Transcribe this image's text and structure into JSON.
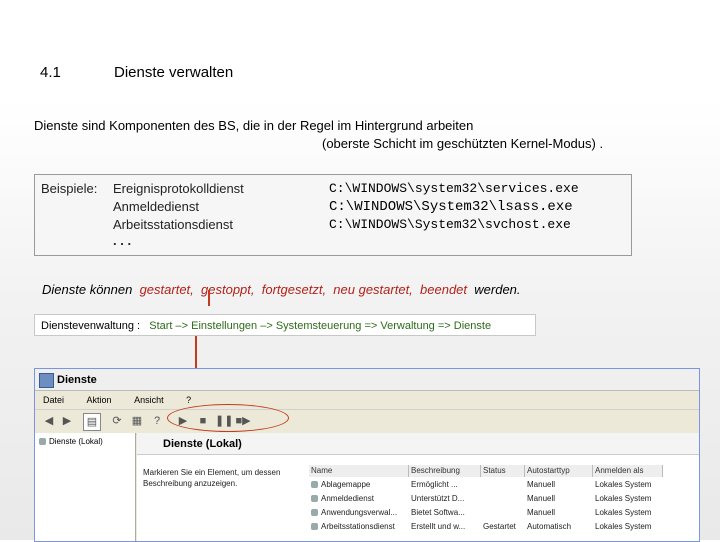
{
  "heading": {
    "number": "4.1",
    "title": "Dienste verwalten"
  },
  "intro": {
    "line1": "Dienste sind Komponenten des BS, die in der Regel im Hintergrund arbeiten",
    "line2": "(oberste Schicht im geschützten Kernel-Modus) ."
  },
  "examples": {
    "label": "Beispiele:",
    "items": [
      "Ereignisprotokolldienst",
      "Anmeldedienst",
      "Arbeitsstationsdienst",
      ". . ."
    ],
    "paths": [
      "C:\\WINDOWS\\system32\\services.exe",
      "C:\\WINDOWS\\System32\\lsass.exe",
      "C:\\WINDOWS\\System32\\svchost.exe"
    ]
  },
  "actions": {
    "prefix": "Dienste können",
    "items": [
      "gestartet,",
      "gestoppt,",
      "fortgesetzt,",
      "neu gestartet,",
      "beendet"
    ],
    "suffix": "werden."
  },
  "path_bar": {
    "label": "Dienstevenwaltung :",
    "path": "Start –> Einstellungen –> Systemsteuerung => Verwaltung => Dienste"
  },
  "window": {
    "title": "Dienste",
    "menu": [
      "Datei",
      "Aktion",
      "Ansicht",
      "?"
    ],
    "tree_item": "Dienste (Lokal)",
    "panel_title": "Dienste (Lokal)",
    "description": "Markieren Sie ein Element, um dessen Beschreibung anzuzeigen.",
    "columns": [
      "Name",
      "Beschreibung",
      "Status",
      "Autostarttyp",
      "Anmelden als"
    ],
    "rows": [
      [
        "Ablagemappe",
        "Ermöglicht ...",
        "",
        "Manuell",
        "Lokales System"
      ],
      [
        "Anmeldedienst",
        "Unterstützt D...",
        "",
        "Manuell",
        "Lokales System"
      ],
      [
        "Anwendungsverwal...",
        "Bietet Softwa...",
        "",
        "Manuell",
        "Lokales System"
      ],
      [
        "Arbeitsstationsdienst",
        "Erstellt und w...",
        "Gestartet",
        "Automatisch",
        "Lokales System"
      ]
    ]
  },
  "colors": {
    "accent_red": "#b2221a",
    "path_green": "#2e6b1a"
  }
}
